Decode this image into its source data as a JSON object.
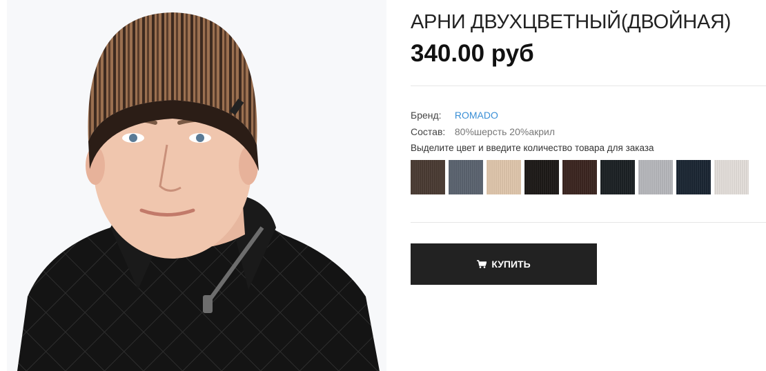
{
  "product": {
    "title": "АРНИ ДВУХЦВЕТНЫЙ(ДВОЙНАЯ)",
    "price": "340.00 руб",
    "image_icon": "product-photo"
  },
  "attributes": {
    "brand_label": "Бренд:",
    "brand_value": "ROMADO",
    "composition_label": "Состав:",
    "composition_value": "80%шерсть 20%акрил"
  },
  "color_hint": "Выделите цвет и введите количество товара для заказа",
  "swatches": [
    {
      "color": "#4a3b33"
    },
    {
      "color": "#5b6470"
    },
    {
      "color": "#e1c8ad"
    },
    {
      "color": "#1d1917"
    },
    {
      "color": "#3b2520"
    },
    {
      "color": "#1c2124"
    },
    {
      "color": "#b8b9bd"
    },
    {
      "color": "#1b2633"
    },
    {
      "color": "#e6e0dc"
    }
  ],
  "buy_button": {
    "label": "КУПИТЬ",
    "icon": "cart-icon"
  },
  "colors": {
    "button_bg": "#222222",
    "link": "#3a8fd6",
    "divider": "#e6e6e6"
  }
}
